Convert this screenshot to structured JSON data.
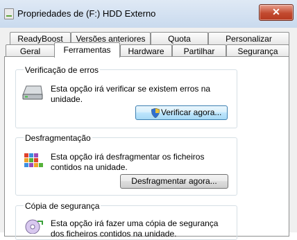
{
  "window": {
    "title": "Propriedades de (F:) HDD Externo",
    "close_label": "✕"
  },
  "tabs_back": [
    "ReadyBoost",
    "Versões anteriores",
    "Quota",
    "Personalizar"
  ],
  "tabs_front": [
    "Geral",
    "Ferramentas",
    "Hardware",
    "Partilhar",
    "Segurança"
  ],
  "active_tab": "Ferramentas",
  "sections": {
    "error_check": {
      "title": "Verificação de erros",
      "description": "Esta opção irá verificar se existem erros na unidade.",
      "button": "Verificar agora..."
    },
    "defrag": {
      "title": "Desfragmentação",
      "description": "Esta opção irá desfragmentar os ficheiros contidos na unidade.",
      "button": "Desfragmentar agora..."
    },
    "backup": {
      "title": "Cópia de segurança",
      "description": "Esta opção irá fazer uma cópia de segurança dos ficheiros contidos na unidade."
    }
  }
}
